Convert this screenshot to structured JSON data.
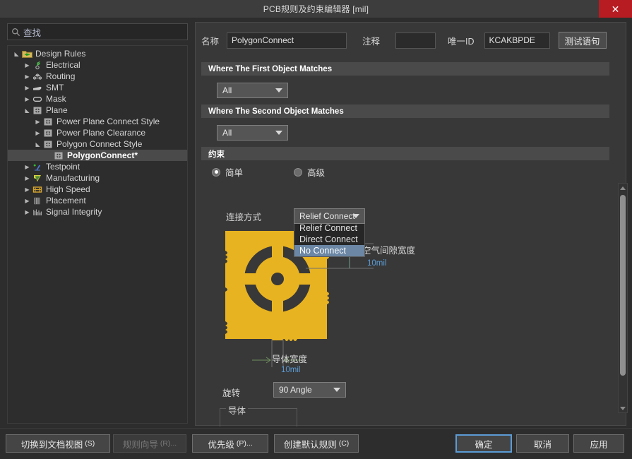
{
  "window": {
    "title": "PCB规则及约束编辑器 [mil]",
    "close_label": "✕"
  },
  "search": {
    "icon": "search-icon",
    "value": "查找",
    "placeholder": "查找"
  },
  "tree": {
    "nodes": [
      {
        "label": "Design Rules",
        "depth": 0,
        "twist": "open",
        "icon": "folder-rules-icon",
        "selected": false
      },
      {
        "label": "Electrical",
        "depth": 1,
        "twist": "closed",
        "icon": "electrical-icon",
        "selected": false
      },
      {
        "label": "Routing",
        "depth": 1,
        "twist": "closed",
        "icon": "routing-icon",
        "selected": false
      },
      {
        "label": "SMT",
        "depth": 1,
        "twist": "closed",
        "icon": "smt-icon",
        "selected": false
      },
      {
        "label": "Mask",
        "depth": 1,
        "twist": "closed",
        "icon": "mask-icon",
        "selected": false
      },
      {
        "label": "Plane",
        "depth": 1,
        "twist": "open",
        "icon": "plane-icon",
        "selected": false
      },
      {
        "label": "Power Plane Connect Style",
        "depth": 2,
        "twist": "closed",
        "icon": "plane-icon",
        "selected": false
      },
      {
        "label": "Power Plane Clearance",
        "depth": 2,
        "twist": "closed",
        "icon": "plane-icon",
        "selected": false
      },
      {
        "label": "Polygon Connect Style",
        "depth": 2,
        "twist": "open",
        "icon": "plane-icon",
        "selected": false
      },
      {
        "label": "PolygonConnect*",
        "depth": 3,
        "twist": "none",
        "icon": "plane-icon",
        "selected": true
      },
      {
        "label": "Testpoint",
        "depth": 1,
        "twist": "closed",
        "icon": "testpoint-icon",
        "selected": false
      },
      {
        "label": "Manufacturing",
        "depth": 1,
        "twist": "closed",
        "icon": "manufacturing-icon",
        "selected": false
      },
      {
        "label": "High Speed",
        "depth": 1,
        "twist": "closed",
        "icon": "highspeed-icon",
        "selected": false
      },
      {
        "label": "Placement",
        "depth": 1,
        "twist": "closed",
        "icon": "placement-icon",
        "selected": false
      },
      {
        "label": "Signal Integrity",
        "depth": 1,
        "twist": "closed",
        "icon": "signalintegrity-icon",
        "selected": false
      }
    ]
  },
  "form": {
    "name_label": "名称",
    "name_value": "PolygonConnect",
    "comment_label": "注释",
    "comment_value": "",
    "uid_label": "唯一ID",
    "uid_value": "KCAKBPDE",
    "test_query_button": "测试语句"
  },
  "first_object": {
    "header": "Where The First Object Matches",
    "scope_value": "All"
  },
  "second_object": {
    "header": "Where The Second Object Matches",
    "scope_value": "All"
  },
  "constraints": {
    "header": "约束",
    "mode_simple": "简单",
    "mode_advanced": "高级",
    "mode_selected": "简单",
    "connect_style_label": "连接方式",
    "connect_style_value": "Relief Connect",
    "connect_style_options": [
      "Relief Connect",
      "Direct Connect",
      "No Connect"
    ],
    "connect_style_highlighted": "No Connect",
    "conductor_width_label": "导体宽度",
    "conductor_width_value": "10mil",
    "air_gap_label": "空气间隙宽度",
    "air_gap_value": "10mil",
    "rotation_label": "旋转",
    "rotation_value": "90 Angle",
    "conductors_group_label": "导体"
  },
  "footer": {
    "buttons": [
      {
        "label": "切换到文档视图",
        "accel": "(S)",
        "disabled": false,
        "primary": false
      },
      {
        "label": "规则向导",
        "accel": "(R)...",
        "disabled": true,
        "primary": false
      },
      {
        "label": "优先级",
        "accel": "(P)...",
        "disabled": false,
        "primary": false
      },
      {
        "label": "创建默认规则",
        "accel": "(C)",
        "disabled": false,
        "primary": false
      }
    ],
    "ok": "确定",
    "cancel": "取消",
    "apply": "应用"
  },
  "colors": {
    "accent": "#5b9bd5",
    "close": "#b81c23",
    "copper": "#e8b320",
    "panel_bg": "#383838",
    "window_bg": "#2d2d2d"
  }
}
